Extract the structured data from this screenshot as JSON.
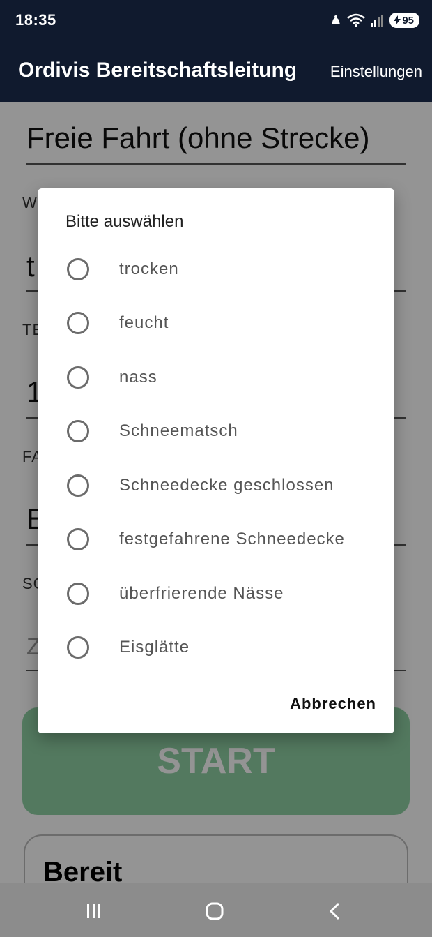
{
  "status_bar": {
    "time": "18:35",
    "battery": "95"
  },
  "app_bar": {
    "title": "Ordivis Bereitschaftsleitung",
    "settings_label": "Einstellungen"
  },
  "form": {
    "route_title": "Freie Fahrt (ohne Strecke)",
    "fields": [
      {
        "label": "W",
        "value": "t"
      },
      {
        "label": "TE",
        "value": "1"
      },
      {
        "label": "FA",
        "value": "E"
      },
      {
        "label": "SC",
        "placeholder": "Z"
      }
    ],
    "start_label": "START",
    "status_card_title": "Bereit"
  },
  "dialog": {
    "title": "Bitte auswählen",
    "options": [
      "trocken",
      "feucht",
      "nass",
      "Schneematsch",
      "Schneedecke geschlossen",
      "festgefahrene Schneedecke",
      "überfrierende Nässe",
      "Eisglätte"
    ],
    "cancel_label": "Abbrechen"
  },
  "colors": {
    "app_bar": "#101a2e",
    "start_button": "#8fd1a4",
    "scrim": "rgba(0,0,0,0.42)"
  }
}
